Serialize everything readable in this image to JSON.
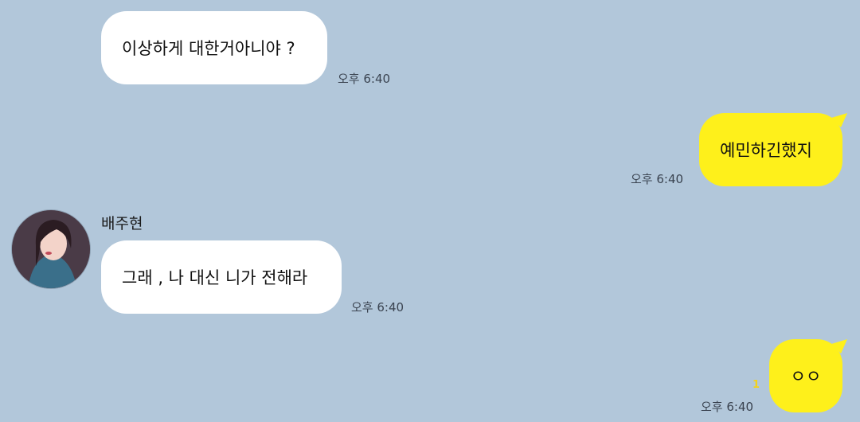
{
  "messages": [
    {
      "direction": "in",
      "text": "이상하게 대한거아니야 ?",
      "time": "오후 6:40"
    },
    {
      "direction": "out",
      "text": "예민하긴했지",
      "time": "오후 6:40"
    },
    {
      "direction": "in",
      "sender": "배주현",
      "avatar": "profile-photo",
      "text": "그래 , 나 대신 니가 전해라",
      "time": "오후 6:40"
    },
    {
      "direction": "out",
      "text": "ㅇㅇ",
      "time": "오후 6:40",
      "unread": "1"
    }
  ],
  "colors": {
    "background": "#b2c7da",
    "incoming": "#ffffff",
    "outgoing": "#fef01b",
    "unread": "#f2d21b"
  }
}
